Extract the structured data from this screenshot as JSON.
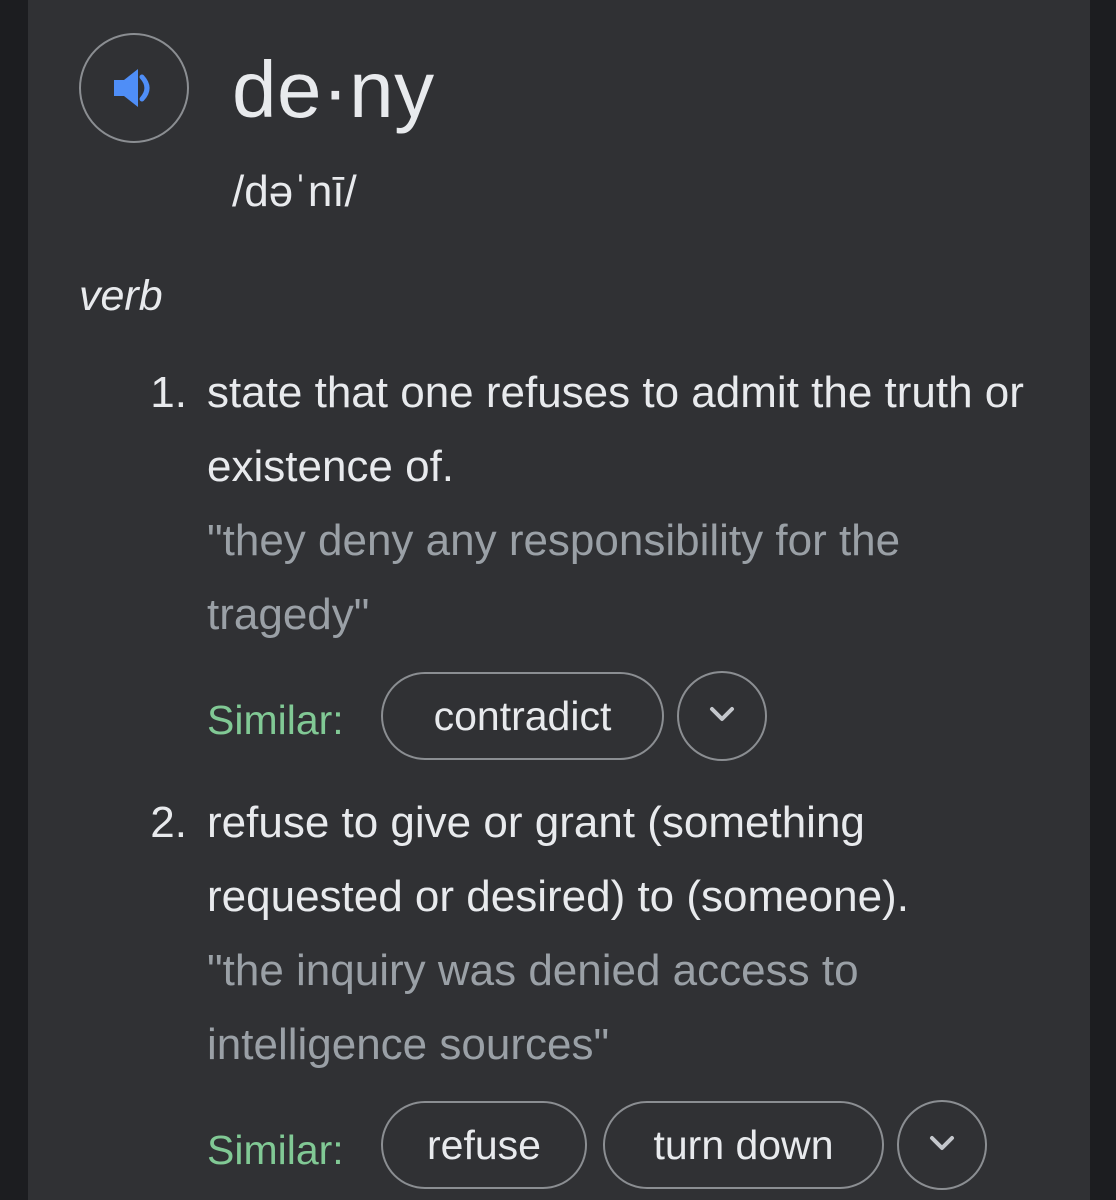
{
  "entry": {
    "word": "de·ny",
    "phonetic": "/dəˈnī/",
    "part_of_speech": "verb",
    "speaker_icon": "volume-icon",
    "accent_color": "#4f8ef7"
  },
  "senses": [
    {
      "number": "1.",
      "definition": "state that one refuses to admit the truth or existence of.",
      "example": "\"they deny any responsibility for the tragedy\"",
      "similar_label": "Similar:",
      "similar": [
        "contradict"
      ],
      "expand_icon": "chevron-down-icon"
    },
    {
      "number": "2.",
      "definition": "refuse to give or grant (something requested or desired) to (someone).",
      "example": "\"the inquiry was denied access to intelligence sources\"",
      "similar_label": "Similar:",
      "similar": [
        "refuse",
        "turn down"
      ],
      "expand_icon": "chevron-down-icon"
    }
  ],
  "colors": {
    "card_background": "#303134",
    "text": "#e8eaed",
    "example_text": "#9aa0a6",
    "similar_label": "#81c995"
  }
}
